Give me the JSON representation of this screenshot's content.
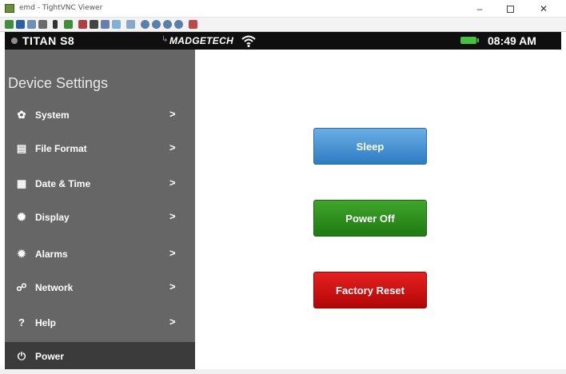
{
  "window": {
    "title": "emd - TightVNC Viewer",
    "minimize": "–",
    "close": "✕"
  },
  "toolbar": {
    "icons": [
      "new-connection-icon",
      "save-icon",
      "options-icon",
      "info-icon",
      "pause-icon",
      "refresh-icon",
      "ctrl-alt-del-icon",
      "ctrl-esc-icon",
      "ctrl-key-icon",
      "alt-key-icon",
      "file-transfer-icon",
      "zoom-in-icon",
      "zoom-out-icon",
      "zoom-100-icon",
      "zoom-fit-icon",
      "fullscreen-icon"
    ]
  },
  "statusbar": {
    "device_name": "TITAN S8",
    "brand": "MADGETECH",
    "clock": "08:49 AM",
    "battery_color": "#45c23d"
  },
  "sidebar": {
    "title": "Device Settings",
    "items": [
      {
        "label": "System",
        "icon": "gear-icon",
        "glyph": "✿"
      },
      {
        "label": "File Format",
        "icon": "file-format-icon",
        "glyph": "▤"
      },
      {
        "label": "Date & Time",
        "icon": "calendar-icon",
        "glyph": "▦"
      },
      {
        "label": "Display",
        "icon": "brightness-icon",
        "glyph": "✺"
      },
      {
        "label": "Alarms",
        "icon": "alarm-icon",
        "glyph": "✹"
      },
      {
        "label": "Network",
        "icon": "network-icon",
        "glyph": "☍"
      },
      {
        "label": "Help",
        "icon": "help-icon",
        "glyph": "?"
      },
      {
        "label": "Power",
        "icon": "power-icon",
        "glyph": "⏻",
        "active": true
      }
    ],
    "chevron": ">"
  },
  "main": {
    "buttons": [
      {
        "label": "Sleep",
        "color": "#3a89cf"
      },
      {
        "label": "Power Off",
        "color": "#2b8e1c"
      },
      {
        "label": "Factory Reset",
        "color": "#cc0d0d"
      }
    ]
  }
}
